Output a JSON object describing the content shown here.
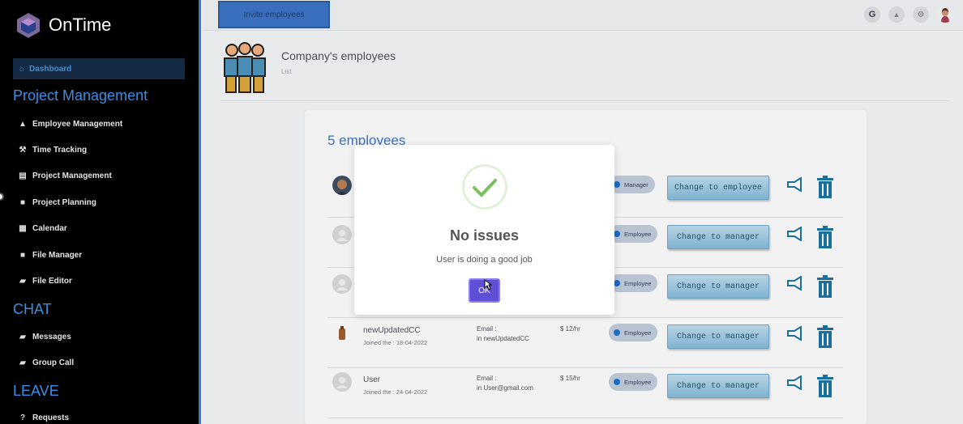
{
  "app": {
    "name": "OnTime"
  },
  "sidebar": {
    "dashboard": {
      "label": "Dashboard",
      "icon": "home-icon"
    },
    "sections": [
      {
        "title": "Project Management",
        "items": [
          {
            "label": "Employee Management",
            "icon": "user-icon"
          },
          {
            "label": "Time Tracking",
            "icon": "wrench-icon"
          },
          {
            "label": "Project Management",
            "icon": "building-icon"
          },
          {
            "label": "Project Planning",
            "icon": "archive-icon"
          },
          {
            "label": "Calendar",
            "icon": "calendar-icon"
          },
          {
            "label": "File Manager",
            "icon": "archive-icon"
          },
          {
            "label": "File Editor",
            "icon": "book-icon"
          }
        ]
      },
      {
        "title": "CHAT",
        "items": [
          {
            "label": "Messages",
            "icon": "book-icon"
          },
          {
            "label": "Group Call",
            "icon": "book-icon"
          }
        ]
      },
      {
        "title": "LEAVE",
        "items": [
          {
            "label": "Requests",
            "icon": "question-icon"
          }
        ]
      }
    ]
  },
  "topbar": {
    "invite_label": "Invite employees",
    "google_label": "G"
  },
  "page": {
    "title": "Company's employees",
    "subtitle": "List"
  },
  "employees": {
    "count_label": "5 employees",
    "email_label": "Email :",
    "rows": [
      {
        "name": "",
        "joined": "",
        "email": "",
        "rate": "",
        "role": "Manager",
        "action": "Change to employee"
      },
      {
        "name": "",
        "joined": "",
        "email": "",
        "rate": "",
        "role": "Employee",
        "action": "Change to manager"
      },
      {
        "name": "",
        "joined": "",
        "email": "",
        "rate": "",
        "role": "Employee",
        "action": "Change to manager"
      },
      {
        "name": "newUpdatedCC",
        "joined": "Joined the : 18-04-2022",
        "email": "in newUpdatedCC",
        "rate": "$ 12/hr",
        "role": "Employee",
        "action": "Change to manager"
      },
      {
        "name": "User",
        "joined": "Joined the : 24-04-2022",
        "email": "in User@gmail.com",
        "rate": "$ 15/hr",
        "role": "Employee",
        "action": "Change to manager"
      }
    ]
  },
  "modal": {
    "title": "No issues",
    "message": "User is doing a good job",
    "ok_label": "OK"
  },
  "colors": {
    "accent": "#3a8ee6",
    "sidebar_bg": "#000000",
    "ok_button": "#5e4fd4",
    "check_green": "#7ac15c"
  }
}
